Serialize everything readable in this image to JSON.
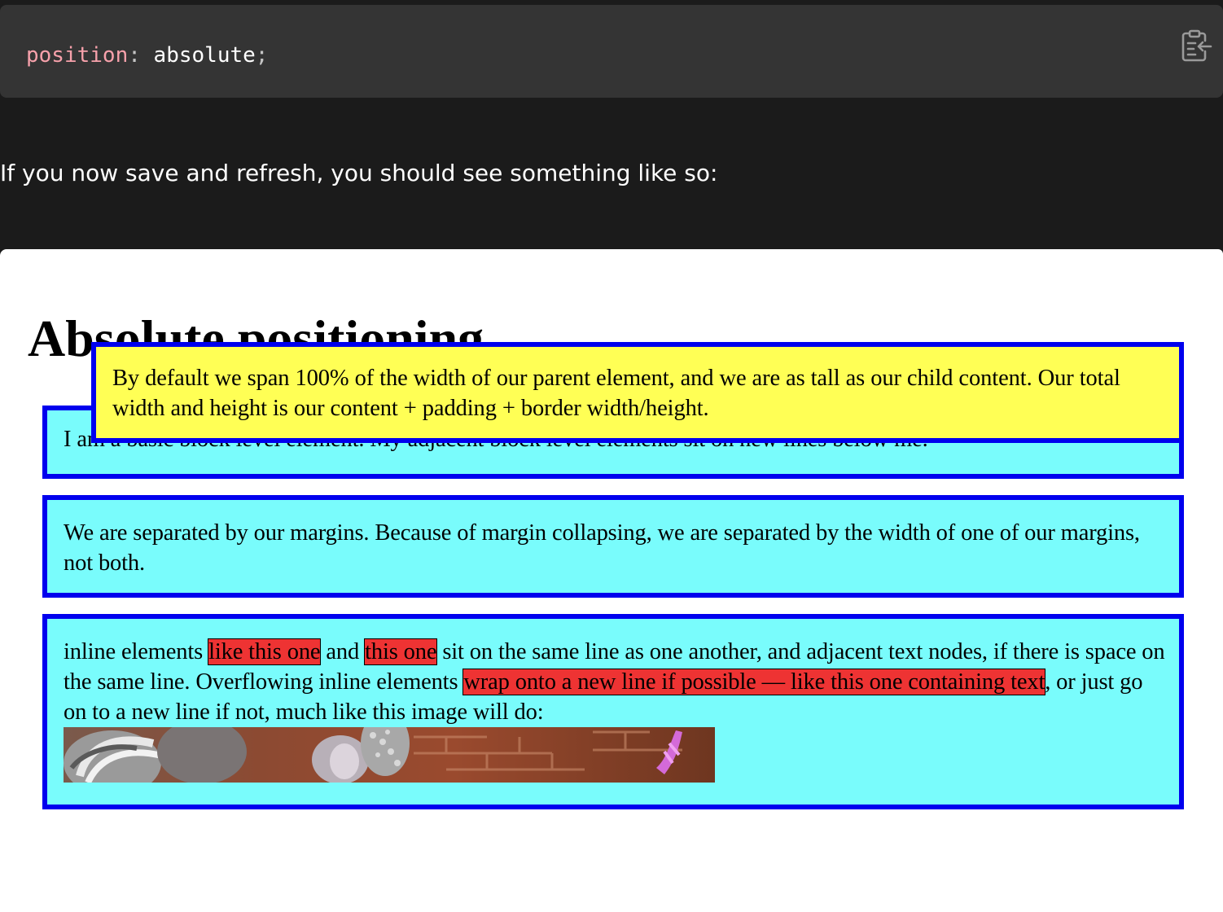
{
  "code": {
    "property": "position",
    "colon": ":",
    "value": "absolute",
    "semicolon": ";",
    "copy_icon": "clipboard-copy-icon"
  },
  "prose": {
    "text": "If you now save and refresh, you should see something like so:"
  },
  "sample": {
    "heading": "Absolute positioning",
    "positioned_box": {
      "text": "By default we span 100% of the width of our parent element, and we are as tall as our child content. Our total width and height is our content + padding + border width/height."
    },
    "block1": {
      "text": "I am a basic block level element. My adjacent block level elements sit on new lines below me."
    },
    "block2": {
      "text": "We are separated by our margins. Because of margin collapsing, we are separated by the width of one of our margins, not both."
    },
    "block3": {
      "text_1": "inline elements ",
      "span_1": "like this one",
      "text_2": " and ",
      "span_2": "this one",
      "text_3": " sit on the same line as one another, and adjacent text nodes, if there is space on the same line. Overflowing inline elements ",
      "span_3": "wrap onto a new line if possible — like this one containing text",
      "text_4": ", or just go on to a new line if not, much like this image will do:"
    },
    "colors": {
      "block_bg": "#79fcfc",
      "block_border": "#0000ee",
      "positioned_bg": "#ffff55",
      "inline_bg": "#ee3333"
    }
  }
}
